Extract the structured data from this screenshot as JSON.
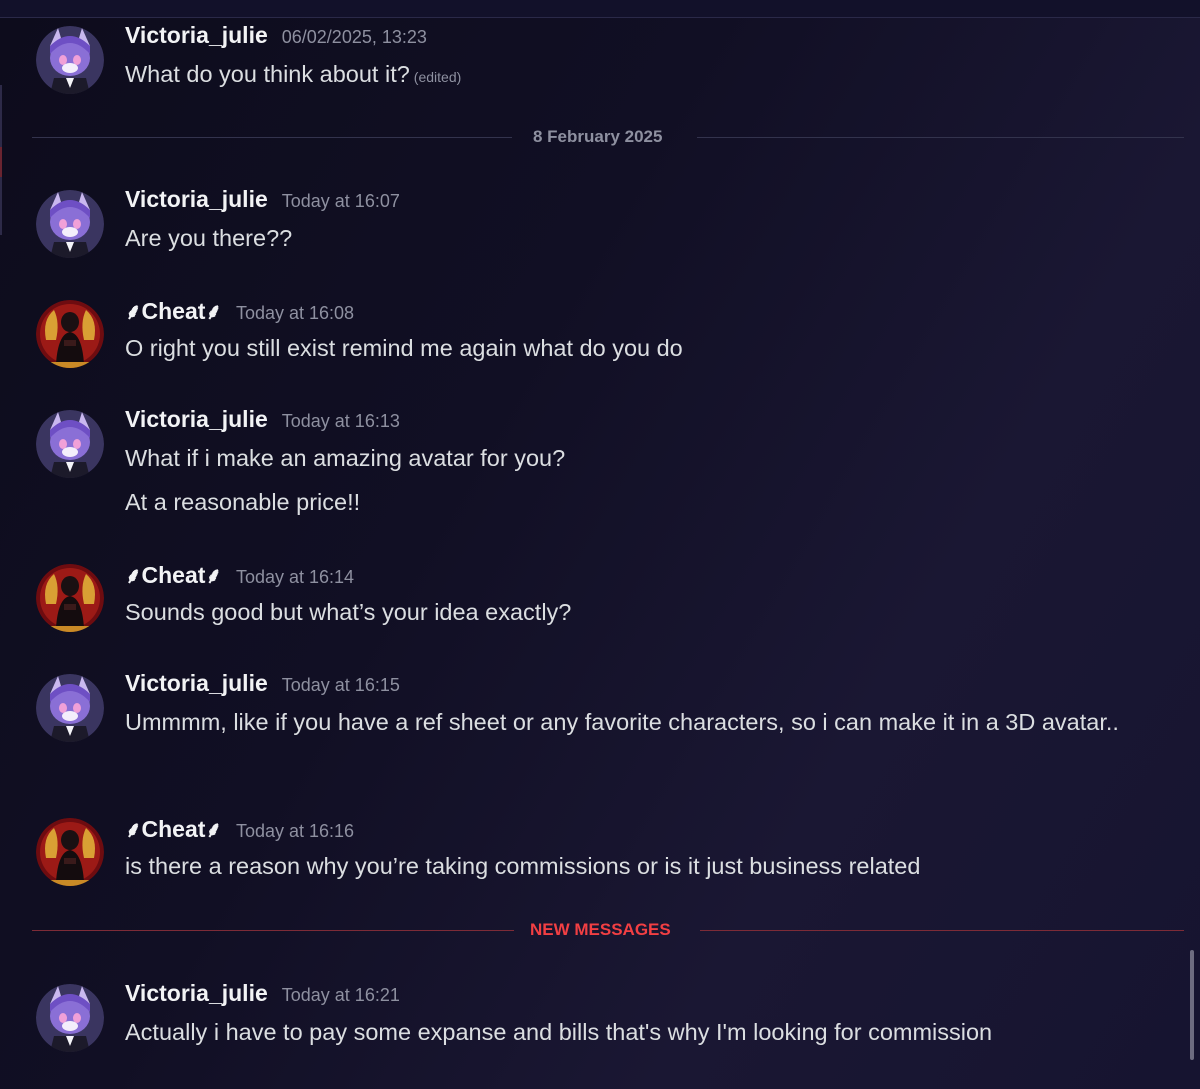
{
  "messages": [
    {
      "user": "Victoria_julie",
      "time": "06/02/2025, 13:23",
      "lines": [
        "What do you think about it?"
      ],
      "edited": "(edited)",
      "avatar": "victoria-avatar"
    },
    {
      "user": "Victoria_julie",
      "time": "Today at 16:07",
      "lines": [
        "Are you there??"
      ],
      "avatar": "victoria-avatar"
    },
    {
      "user": "Cheat",
      "deco_left": "⸙ ",
      "deco_right": "⸙",
      "time": "Today at 16:08",
      "lines": [
        "O right you still exist remind me again what do you do"
      ],
      "avatar": "cheat-avatar"
    },
    {
      "user": "Victoria_julie",
      "time": "Today at 16:13",
      "lines": [
        "What if i make an amazing avatar for you?",
        "At a reasonable price!!"
      ],
      "avatar": "victoria-avatar"
    },
    {
      "user": "Cheat",
      "deco_left": "⸙ ",
      "deco_right": "⸙",
      "time": "Today at 16:14",
      "lines": [
        "Sounds good but what’s your idea exactly?"
      ],
      "avatar": "cheat-avatar"
    },
    {
      "user": "Victoria_julie",
      "time": "Today at 16:15",
      "lines": [
        "Ummmm, like if you have a ref sheet or any favorite characters, so i can make it in a 3D avatar.."
      ],
      "avatar": "victoria-avatar"
    },
    {
      "user": "Cheat",
      "deco_left": "⸙ ",
      "deco_right": "⸙",
      "time": "Today at 16:16",
      "lines": [
        "is there a reason why you’re taking commissions or is it just business related"
      ],
      "avatar": "cheat-avatar"
    },
    {
      "user": "Victoria_julie",
      "time": "Today at 16:21",
      "lines": [
        "Actually i have to pay some expanse and bills that's why I'm looking for commission"
      ],
      "avatar": "victoria-avatar"
    }
  ],
  "dividers": {
    "date": "8 February 2025",
    "new": "NEW MESSAGES"
  },
  "colors": {
    "new_messages": "#f23f43",
    "username": "#f2f3f5",
    "timestamp": "#8e90a0"
  }
}
